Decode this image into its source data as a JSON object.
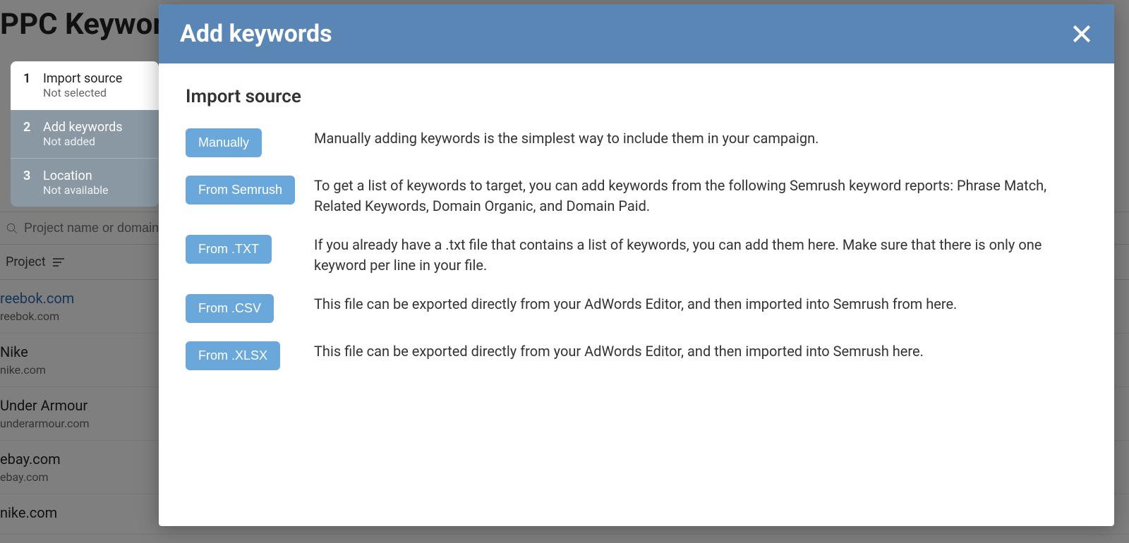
{
  "background": {
    "page_title": "PPC Keyword",
    "search_placeholder": "Project name or domain",
    "project_header": "Project",
    "projects": [
      {
        "name": "reebok.com",
        "domain": "reebok.com"
      },
      {
        "name": "Nike",
        "domain": "nike.com"
      },
      {
        "name": "Under Armour",
        "domain": "underarmour.com"
      },
      {
        "name": "ebay.com",
        "domain": "ebay.com"
      },
      {
        "name": "nike.com",
        "domain": ""
      }
    ]
  },
  "steps": [
    {
      "num": "1",
      "label": "Import source",
      "sub": "Not selected"
    },
    {
      "num": "2",
      "label": "Add keywords",
      "sub": "Not added"
    },
    {
      "num": "3",
      "label": "Location",
      "sub": "Not available"
    }
  ],
  "modal": {
    "title": "Add keywords",
    "section_title": "Import source",
    "options": [
      {
        "button": "Manually",
        "desc": "Manually adding keywords is the simplest way to include them in your campaign."
      },
      {
        "button": "From Semrush",
        "desc": "To get a list of keywords to target, you can add keywords from the following Semrush keyword reports: Phrase Match, Related Keywords, Domain Organic, and Domain Paid."
      },
      {
        "button": "From .TXT",
        "desc": "If you already have a .txt file that contains a list of keywords, you can add them here. Make sure that there is only one keyword per line in your file."
      },
      {
        "button": "From .CSV",
        "desc": "This file can be exported directly from your AdWords Editor, and then imported into Semrush from here."
      },
      {
        "button": "From .XLSX",
        "desc": "This file can be exported directly from your AdWords Editor, and then imported into Semrush here."
      }
    ]
  }
}
